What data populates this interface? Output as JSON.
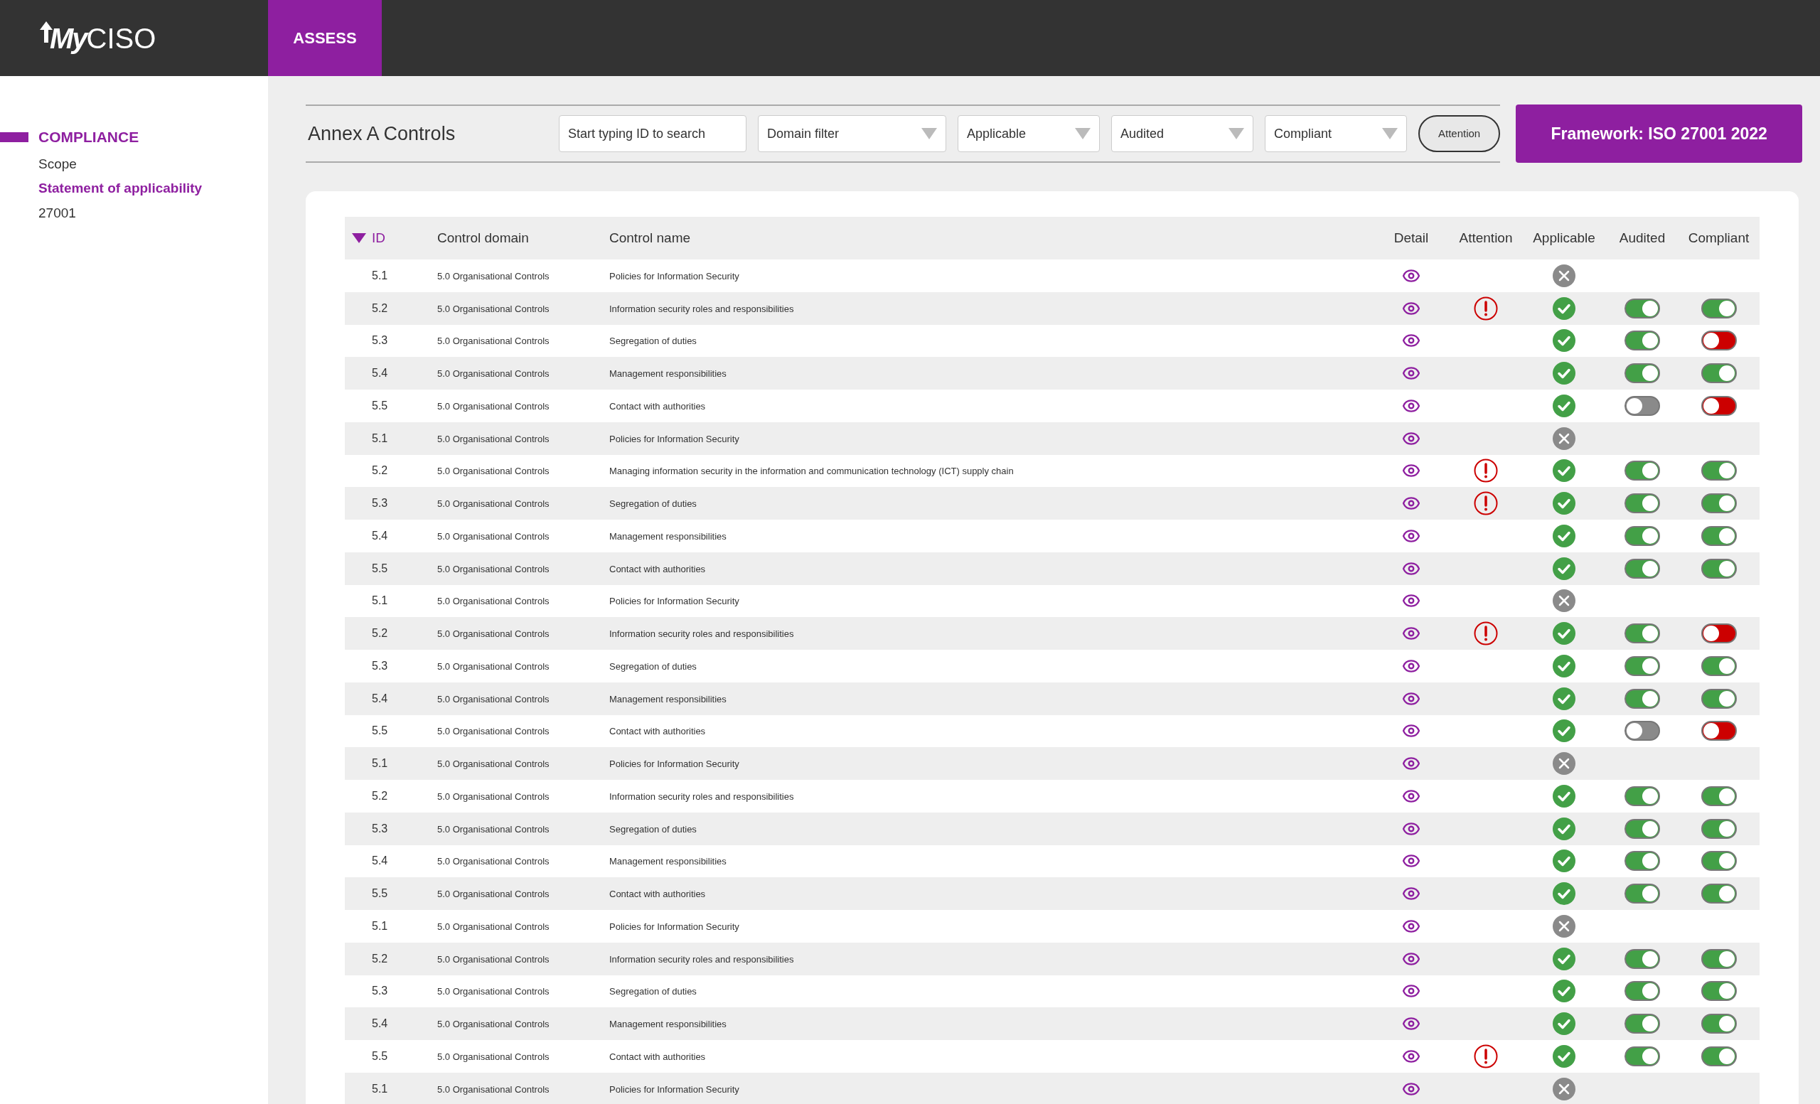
{
  "logo": {
    "prefix": "My",
    "name": "CISO"
  },
  "nav_tabs": [
    {
      "label": "ASSESS",
      "selected": true
    }
  ],
  "sidebar": {
    "items": [
      {
        "label": "COMPLIANCE",
        "kind": "heading",
        "selected": true
      },
      {
        "label": "Scope",
        "kind": "link",
        "selected": false
      },
      {
        "label": "Statement of applicability",
        "kind": "link",
        "selected": true
      },
      {
        "label": "27001",
        "kind": "link",
        "selected": false
      }
    ]
  },
  "toolbar": {
    "title": "Annex A Controls",
    "search": {
      "placeholder": "Start typing ID to search"
    },
    "filters": [
      {
        "label": "Domain filter"
      },
      {
        "label": "Applicable"
      },
      {
        "label": "Audited"
      },
      {
        "label": "Compliant"
      }
    ],
    "attention_button": "Attention"
  },
  "framework_button": "Framework: ISO 27001 2022",
  "table": {
    "columns": [
      {
        "label": "ID",
        "sorted": true
      },
      {
        "label": "Control domain",
        "sorted": false
      },
      {
        "label": "Control name",
        "sorted": false
      },
      {
        "label": "Detail",
        "sorted": false
      },
      {
        "label": "Attention",
        "sorted": false
      },
      {
        "label": "Applicable",
        "sorted": false
      },
      {
        "label": "Audited",
        "sorted": false
      },
      {
        "label": "Compliant",
        "sorted": false
      }
    ],
    "rows": [
      {
        "id": "5.1",
        "domain": "5.0 Organisational Controls",
        "name": "Policies for Information Security",
        "attention": false,
        "applicable": false
      },
      {
        "id": "5.2",
        "domain": "5.0 Organisational Controls",
        "name": "Information security roles and responsibilities",
        "attention": true,
        "applicable": true,
        "audited": true,
        "compliant": true
      },
      {
        "id": "5.3",
        "domain": "5.0 Organisational Controls",
        "name": "Segregation of duties",
        "attention": false,
        "applicable": true,
        "audited": true,
        "compliant": false
      },
      {
        "id": "5.4",
        "domain": "5.0 Organisational Controls",
        "name": "Management responsibilities",
        "attention": false,
        "applicable": true,
        "audited": true,
        "compliant": true
      },
      {
        "id": "5.5",
        "domain": "5.0 Organisational Controls",
        "name": "Contact with authorities",
        "attention": false,
        "applicable": true,
        "audited": false,
        "compliant": false
      },
      {
        "id": "5.1",
        "domain": "5.0 Organisational Controls",
        "name": "Policies for Information Security",
        "attention": false,
        "applicable": false
      },
      {
        "id": "5.2",
        "domain": "5.0 Organisational Controls",
        "name": "Managing information security in the information and communication technology (ICT) supply chain",
        "attention": true,
        "applicable": true,
        "audited": true,
        "compliant": true
      },
      {
        "id": "5.3",
        "domain": "5.0 Organisational Controls",
        "name": "Segregation of duties",
        "attention": true,
        "applicable": true,
        "audited": true,
        "compliant": true
      },
      {
        "id": "5.4",
        "domain": "5.0 Organisational Controls",
        "name": "Management responsibilities",
        "attention": false,
        "applicable": true,
        "audited": true,
        "compliant": true
      },
      {
        "id": "5.5",
        "domain": "5.0 Organisational Controls",
        "name": "Contact with authorities",
        "attention": false,
        "applicable": true,
        "audited": true,
        "compliant": true
      },
      {
        "id": "5.1",
        "domain": "5.0 Organisational Controls",
        "name": "Policies for Information Security",
        "attention": false,
        "applicable": false
      },
      {
        "id": "5.2",
        "domain": "5.0 Organisational Controls",
        "name": "Information security roles and responsibilities",
        "attention": true,
        "applicable": true,
        "audited": true,
        "compliant": false
      },
      {
        "id": "5.3",
        "domain": "5.0 Organisational Controls",
        "name": "Segregation of duties",
        "attention": false,
        "applicable": true,
        "audited": true,
        "compliant": true
      },
      {
        "id": "5.4",
        "domain": "5.0 Organisational Controls",
        "name": "Management responsibilities",
        "attention": false,
        "applicable": true,
        "audited": true,
        "compliant": true
      },
      {
        "id": "5.5",
        "domain": "5.0 Organisational Controls",
        "name": "Contact with authorities",
        "attention": false,
        "applicable": true,
        "audited": false,
        "compliant": false
      },
      {
        "id": "5.1",
        "domain": "5.0 Organisational Controls",
        "name": "Policies for Information Security",
        "attention": false,
        "applicable": false
      },
      {
        "id": "5.2",
        "domain": "5.0 Organisational Controls",
        "name": "Information security roles and responsibilities",
        "attention": false,
        "applicable": true,
        "audited": true,
        "compliant": true
      },
      {
        "id": "5.3",
        "domain": "5.0 Organisational Controls",
        "name": "Segregation of duties",
        "attention": false,
        "applicable": true,
        "audited": true,
        "compliant": true
      },
      {
        "id": "5.4",
        "domain": "5.0 Organisational Controls",
        "name": "Management responsibilities",
        "attention": false,
        "applicable": true,
        "audited": true,
        "compliant": true
      },
      {
        "id": "5.5",
        "domain": "5.0 Organisational Controls",
        "name": "Contact with authorities",
        "attention": false,
        "applicable": true,
        "audited": true,
        "compliant": true
      },
      {
        "id": "5.1",
        "domain": "5.0 Organisational Controls",
        "name": "Policies for Information Security",
        "attention": false,
        "applicable": false
      },
      {
        "id": "5.2",
        "domain": "5.0 Organisational Controls",
        "name": "Information security roles and responsibilities",
        "attention": false,
        "applicable": true,
        "audited": true,
        "compliant": true
      },
      {
        "id": "5.3",
        "domain": "5.0 Organisational Controls",
        "name": "Segregation of duties",
        "attention": false,
        "applicable": true,
        "audited": true,
        "compliant": true
      },
      {
        "id": "5.4",
        "domain": "5.0 Organisational Controls",
        "name": "Management responsibilities",
        "attention": false,
        "applicable": true,
        "audited": true,
        "compliant": true
      },
      {
        "id": "5.5",
        "domain": "5.0 Organisational Controls",
        "name": "Contact with authorities",
        "attention": true,
        "applicable": true,
        "audited": true,
        "compliant": true
      },
      {
        "id": "5.1",
        "domain": "5.0 Organisational Controls",
        "name": "Policies for Information Security",
        "attention": false,
        "applicable": false
      }
    ]
  }
}
